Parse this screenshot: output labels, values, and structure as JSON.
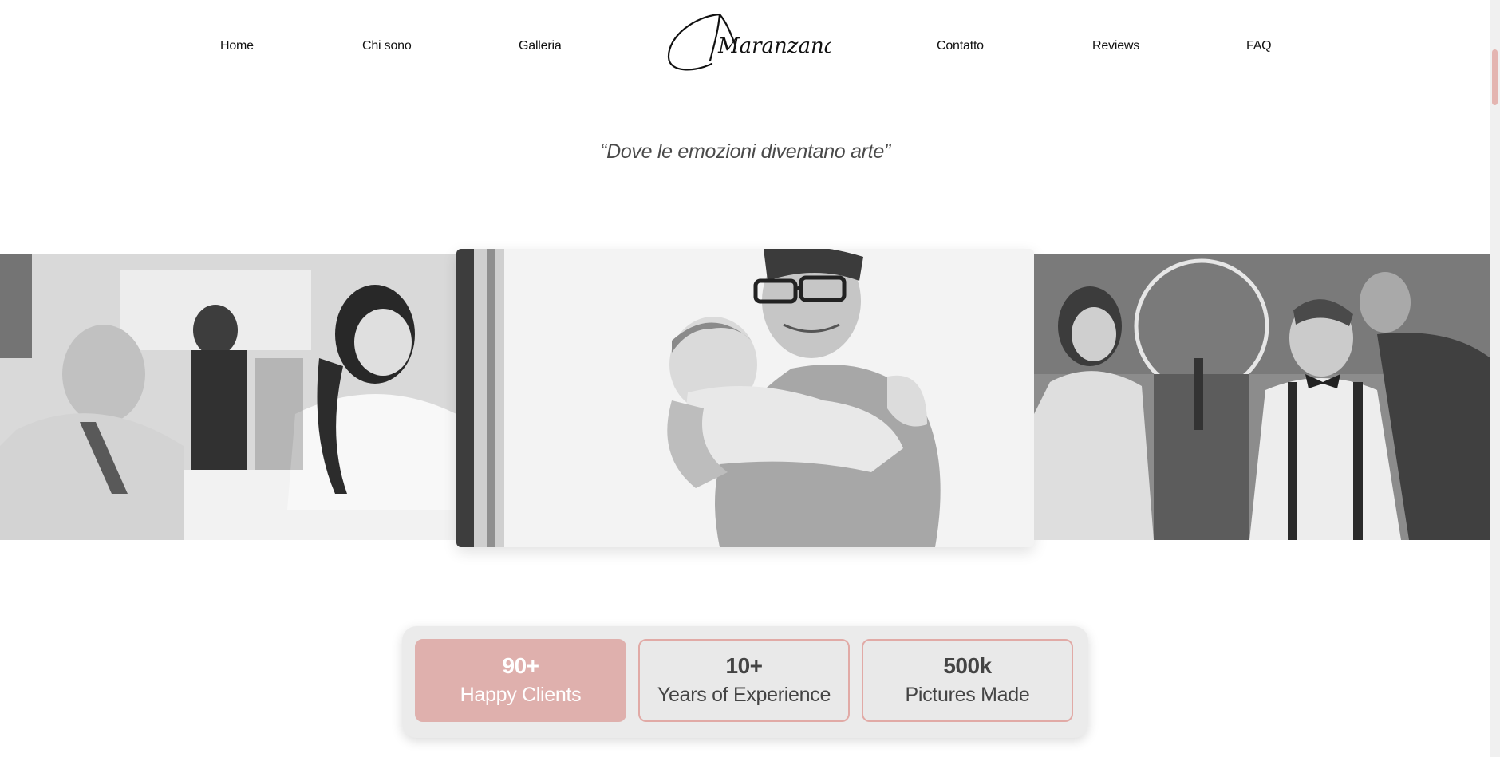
{
  "nav": {
    "items": [
      {
        "label": "Home"
      },
      {
        "label": "Chi sono"
      },
      {
        "label": "Galleria"
      },
      {
        "label": "Contatto"
      },
      {
        "label": "Reviews"
      },
      {
        "label": "FAQ"
      }
    ],
    "logo_text": "Maranzana"
  },
  "hero": {
    "tagline": "“Dove le emozioni diventano arte”"
  },
  "stats": [
    {
      "value": "90+",
      "label": "Happy Clients",
      "active": true
    },
    {
      "value": "10+",
      "label": "Years of Experience",
      "active": false
    },
    {
      "value": "500k",
      "label": "Pictures Made",
      "active": false
    }
  ],
  "colors": {
    "accent": "#dfb0ad",
    "accent_border": "#e1aaa6",
    "text": "#111111",
    "tagline": "#4a4a4a"
  }
}
